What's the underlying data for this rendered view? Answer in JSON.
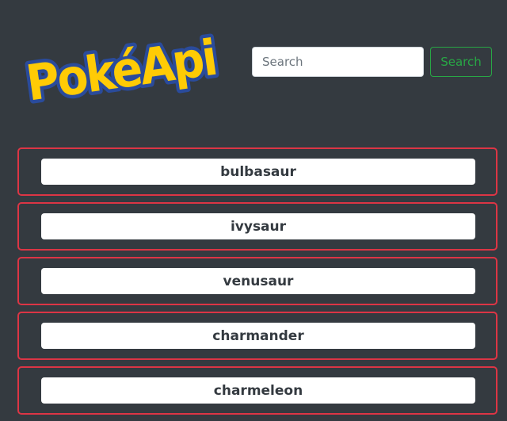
{
  "header": {
    "logo_text": "PokéAPI",
    "search_placeholder": "Search",
    "search_value": "",
    "search_button_label": "Search"
  },
  "pokemon_list": [
    {
      "name": "bulbasaur"
    },
    {
      "name": "ivysaur"
    },
    {
      "name": "venusaur"
    },
    {
      "name": "charmander"
    },
    {
      "name": "charmeleon"
    }
  ],
  "colors": {
    "background": "#343a40",
    "card_border": "#dc3545",
    "search_button": "#28a745",
    "logo_yellow": "#ffcb05",
    "logo_blue": "#2a4b9b"
  }
}
